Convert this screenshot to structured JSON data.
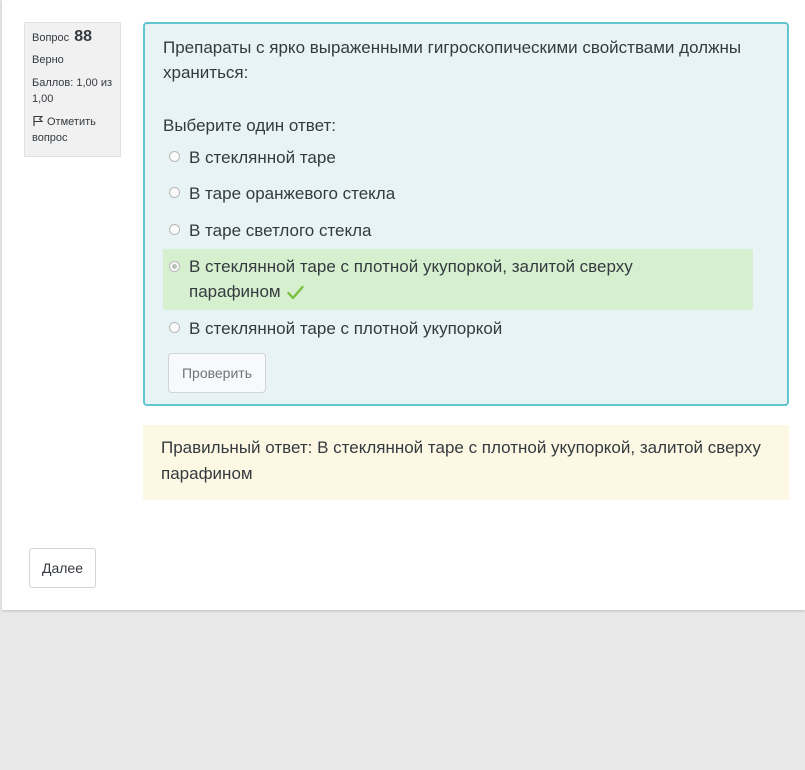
{
  "info": {
    "question_label": "Вопрос",
    "question_number": "88",
    "state": "Верно",
    "grade": "Баллов: 1,00 из 1,00",
    "flag_label": "Отметить вопрос"
  },
  "question": {
    "text": "Препараты с ярко выраженными гигроскопическими свойствами должны храниться:",
    "prompt": "Выберите один ответ:",
    "answers": [
      {
        "label": "В стеклянной таре",
        "selected": false,
        "correct": false
      },
      {
        "label": "В таре оранжевого стекла",
        "selected": false,
        "correct": false
      },
      {
        "label": "В таре светлого стекла",
        "selected": false,
        "correct": false
      },
      {
        "label": "В стеклянной таре с плотной укупоркой, залитой сверху парафином",
        "selected": true,
        "correct": true
      },
      {
        "label": "В стеклянной таре с плотной укупоркой",
        "selected": false,
        "correct": false
      }
    ],
    "check_button": "Проверить"
  },
  "feedback": {
    "right_answer": "Правильный ответ: В стеклянной таре с плотной укупоркой, залитой сверху парафином"
  },
  "navigation": {
    "next_button": "Далее"
  },
  "colors": {
    "accent_border": "#62c6cf",
    "content_bg": "#e7f3f5",
    "correct_bg": "#d6f0cf",
    "check_mark": "#7bbf3f",
    "outcome_bg": "#fcf8e3"
  }
}
